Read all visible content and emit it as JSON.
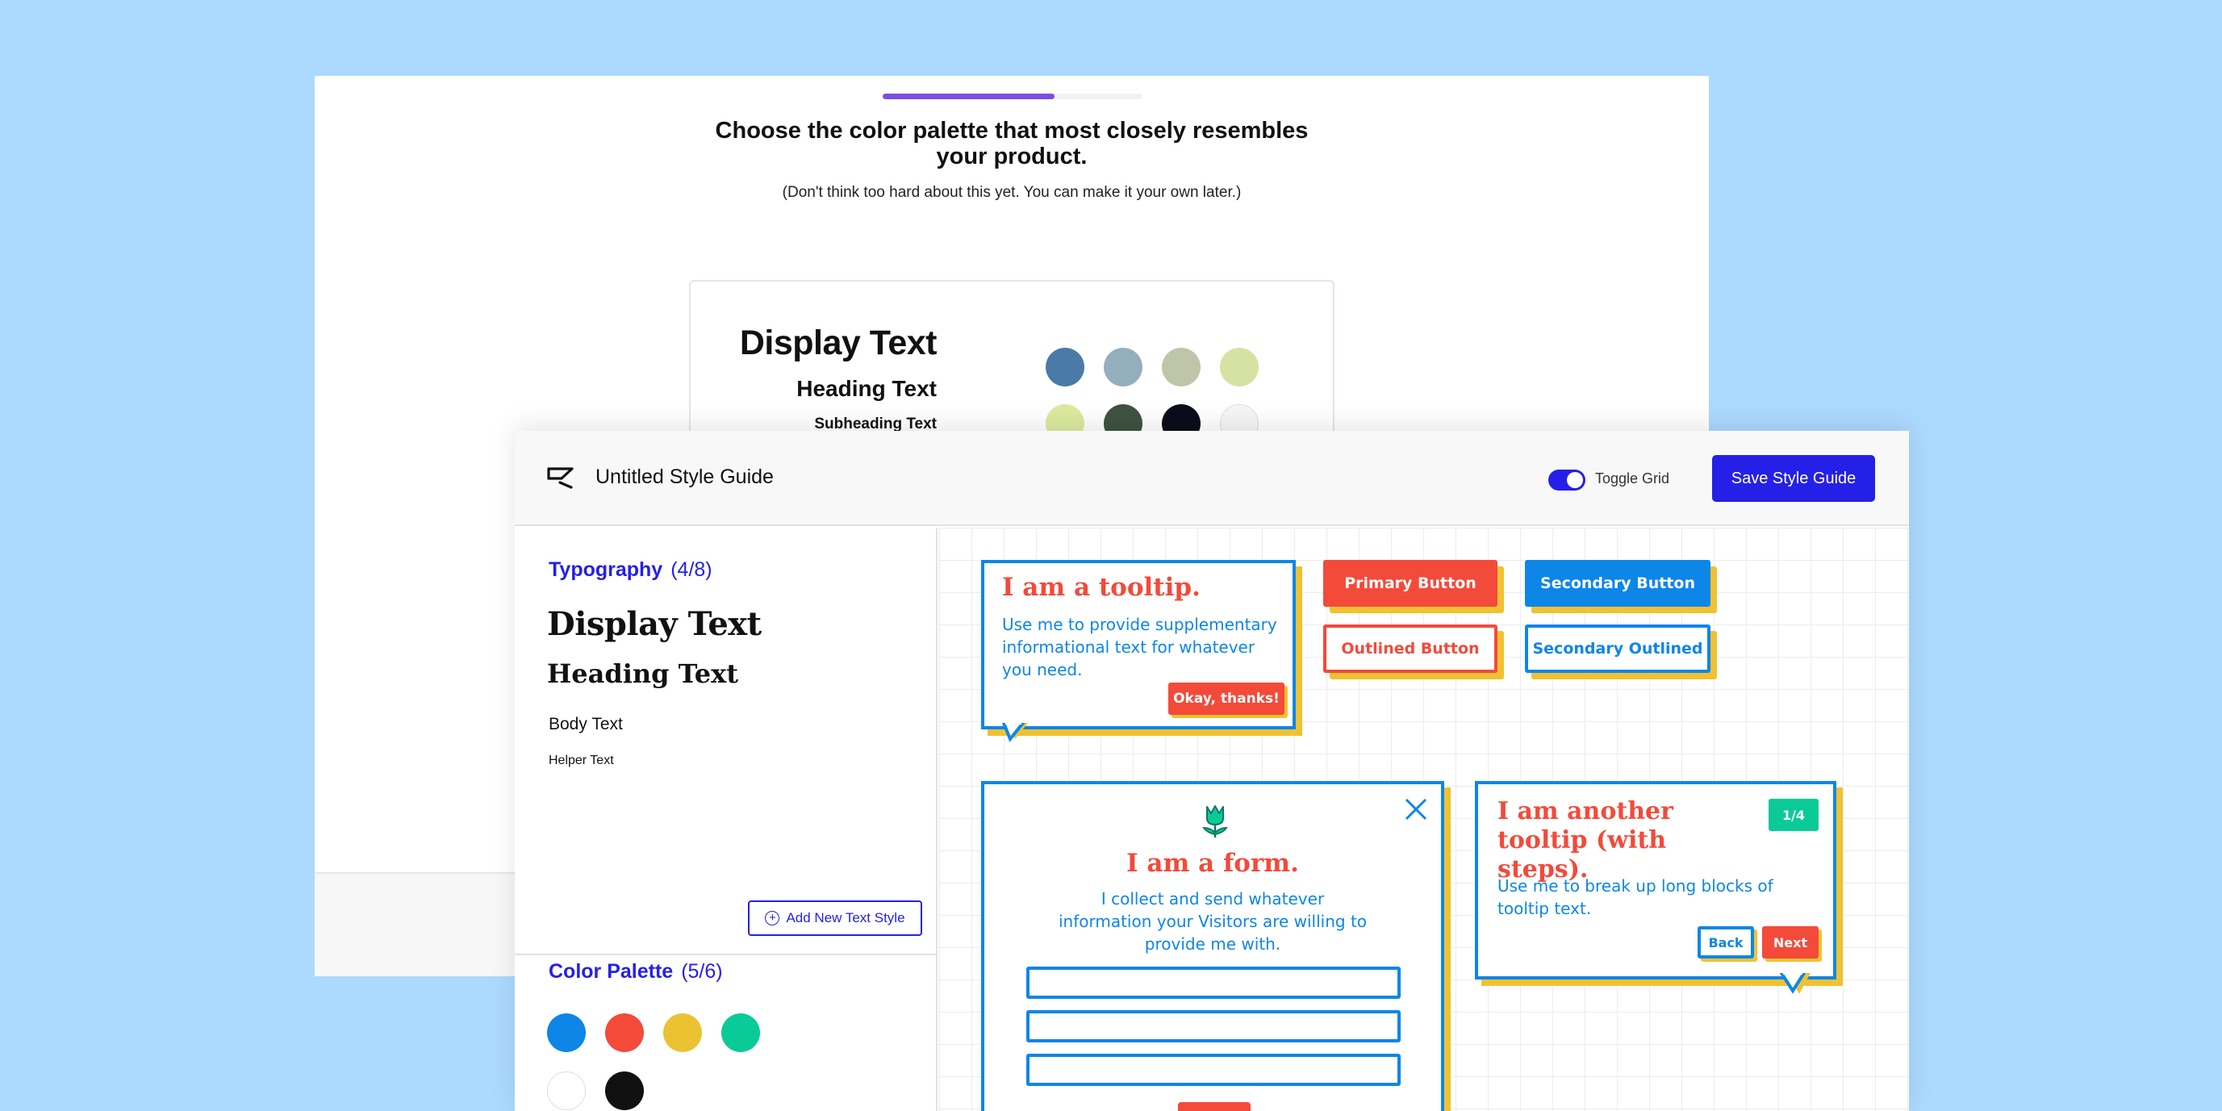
{
  "onboarding": {
    "progress": 0.66,
    "heading": "Choose the color palette that most closely resembles your product.",
    "subtext": "(Don't think too hard about this yet. You can make it your own later.)",
    "preview": {
      "display": "Display Text",
      "heading": "Heading Text",
      "subheading": "Subheading Text",
      "swatches": [
        "#4a7ba8",
        "#95aebd",
        "#bfc5a8",
        "#d6e2a2",
        "#dcea9e",
        "#3f5340",
        "#0c0d1c",
        "#f6f6f6"
      ]
    }
  },
  "app": {
    "title": "Untitled Style Guide",
    "toggle_label": "Toggle Grid",
    "toggle_on": true,
    "save_label": "Save Style Guide"
  },
  "sidebar": {
    "typography": {
      "label": "Typography",
      "count": "(4/8)",
      "display": "Display Text",
      "heading": "Heading Text",
      "body": "Body Text",
      "helper": "Helper Text",
      "add_label": "Add New Text Style"
    },
    "palette": {
      "label": "Color Palette",
      "count": "(5/6)",
      "colors": [
        "#0d86e8",
        "#f34a3a",
        "#ebc232",
        "#0acb97",
        "#ffffff",
        "#111111"
      ]
    }
  },
  "canvas": {
    "tooltip": {
      "title": "I am a tooltip.",
      "body": "Use me to provide supplementary informational text for whatever you need.",
      "action": "Okay, thanks!"
    },
    "buttons": {
      "primary": "Primary Button",
      "secondary": "Secondary Button",
      "outlined": "Outlined Button",
      "secondary_outlined": "Secondary Outlined"
    },
    "form": {
      "title": "I am a form.",
      "body": "I collect and send whatever information your Visitors are willing to provide me with."
    },
    "tooltip_steps": {
      "title": "I am another tooltip (with steps).",
      "step": "1/4",
      "body": "Use me to break up long blocks of tooltip text.",
      "back": "Back",
      "next": "Next"
    }
  },
  "colors": {
    "accent": "#2520e8",
    "blue": "#0d86e8",
    "red": "#f34a3a",
    "yellow": "#f0c232",
    "green": "#0acb97",
    "progress": "#7b4fe0"
  }
}
